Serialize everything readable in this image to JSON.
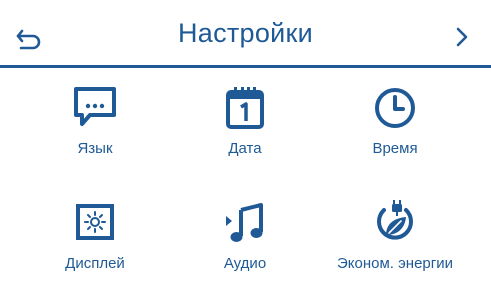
{
  "header": {
    "title": "Настройки",
    "back_icon": "back-arrow-icon",
    "next_icon": "chevron-right-icon"
  },
  "colors": {
    "accent": "#1f5a96",
    "background": "#ffffff"
  },
  "grid": {
    "items": [
      {
        "label": "Язык",
        "icon": "speech-bubble-icon"
      },
      {
        "label": "Дата",
        "icon": "calendar-icon"
      },
      {
        "label": "Время",
        "icon": "clock-icon"
      },
      {
        "label": "Дисплей",
        "icon": "display-brightness-icon"
      },
      {
        "label": "Аудио",
        "icon": "music-note-icon"
      },
      {
        "label": "Эконом. энергии",
        "icon": "energy-saving-icon"
      }
    ]
  }
}
